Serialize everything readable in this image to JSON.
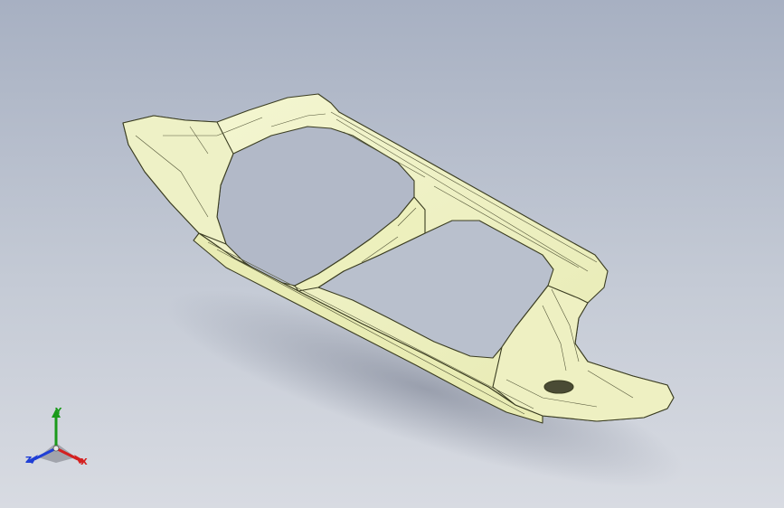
{
  "viewport": {
    "background_top": "#a7b0c2",
    "background_bottom": "#d8dbe2"
  },
  "model": {
    "part_fill": "#f2f4c9",
    "part_shade": "#e3e6a8",
    "edge_color": "#3b3d22"
  },
  "triad": {
    "x_label": "X",
    "y_label": "Y",
    "z_label": "Z",
    "x_color": "#d42020",
    "y_color": "#1a9a1a",
    "z_color": "#1f3fd6"
  }
}
